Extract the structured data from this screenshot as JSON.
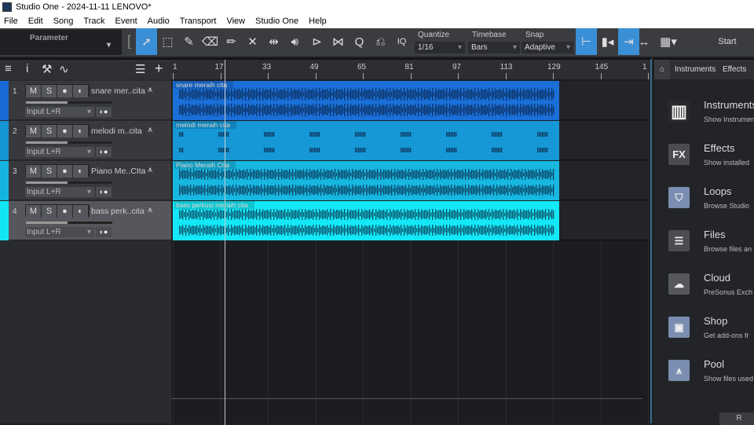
{
  "window": {
    "title": "Studio One - 2024-11-11 LENOVO*"
  },
  "menu": [
    "File",
    "Edit",
    "Song",
    "Track",
    "Event",
    "Audio",
    "Transport",
    "View",
    "Studio One",
    "Help"
  ],
  "toolbar": {
    "parameter": "Parameter",
    "iq": "IQ",
    "quantize_label": "Quantize",
    "quantize": "1/16",
    "timebase_label": "Timebase",
    "timebase": "Bars",
    "snap_label": "Snap",
    "snap": "Adaptive",
    "start": "Start"
  },
  "ruler": [
    "1",
    "17",
    "33",
    "49",
    "65",
    "81",
    "97",
    "113",
    "129",
    "145",
    "1"
  ],
  "tracks": [
    {
      "num": "1",
      "name": "snare mer..cita",
      "input": "Input L+R",
      "event": "snare meraih cita",
      "color": "#1868d6",
      "event_color": "#1a6fd8"
    },
    {
      "num": "2",
      "name": "melodi m..cita",
      "input": "Input L+R",
      "event": "melodi meraih cita",
      "color": "#1595d4",
      "event_color": "#1698d6"
    },
    {
      "num": "3",
      "name": "Piano Me..CIta",
      "input": "Input L+R",
      "event": "Piano Meraih CIta",
      "color": "#14b4de",
      "event_color": "#17b7e0"
    },
    {
      "num": "4",
      "name": "bass perk..cita",
      "input": "Input L+R",
      "event": "bass perkusi meraih cita",
      "color": "#12e6f4",
      "event_color": "#14e8f6"
    }
  ],
  "track_buttons": {
    "mute": "M",
    "solo": "S"
  },
  "browser": {
    "tabs": [
      "Instruments",
      "Effects"
    ],
    "items": [
      {
        "title": "Instruments",
        "sub": "Show Instruments",
        "icon": "piano-icon"
      },
      {
        "title": "Effects",
        "sub": "Show installed",
        "icon": "fx-icon"
      },
      {
        "title": "Loops",
        "sub": "Browse Studio",
        "icon": "loops-icon"
      },
      {
        "title": "Files",
        "sub": "Browse files an",
        "icon": "files-icon"
      },
      {
        "title": "Cloud",
        "sub": "PreSonus Exch",
        "icon": "cloud-icon"
      },
      {
        "title": "Shop",
        "sub": "Get add-ons fr",
        "icon": "shop-icon"
      },
      {
        "title": "Pool",
        "sub": "Show files used",
        "icon": "pool-icon"
      }
    ],
    "bottom_button": "R"
  }
}
